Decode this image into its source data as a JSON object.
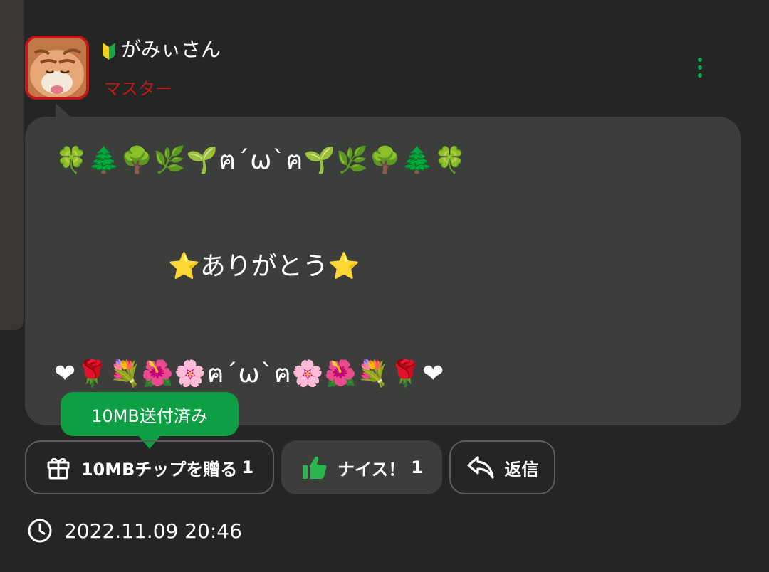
{
  "user": {
    "name": "がみぃさん",
    "rank": "マスター",
    "beginner_icon": "beginner-mark-icon",
    "avatar": "cat-avatar"
  },
  "message": {
    "line1": "🍀🌲🌳🌿🌱ฅ´ω`ฅ🌱🌿🌳🌲🍀",
    "line2": "⭐ありがとう⭐",
    "line3": "❤🌹💐🌺🌸ฅ´ω`ฅ🌸🌺💐🌹❤"
  },
  "sent_badge": {
    "label": "10MB送付済み"
  },
  "actions": {
    "gift": {
      "label": "10MBチップを贈る",
      "count": "1",
      "icon": "gift-icon"
    },
    "nice": {
      "label": "ナイス！",
      "count": "1",
      "icon": "thumbs-up-icon"
    },
    "reply": {
      "label": "返信",
      "icon": "reply-icon"
    }
  },
  "timestamp": {
    "value": "2022.11.09 20:46",
    "icon": "clock-icon"
  },
  "menu": {
    "icon": "more-vertical-icon"
  },
  "colors": {
    "background": "#242625",
    "bubble": "#3c3e3c",
    "accent_green": "#0e9e43",
    "rank_red": "#c01818"
  }
}
